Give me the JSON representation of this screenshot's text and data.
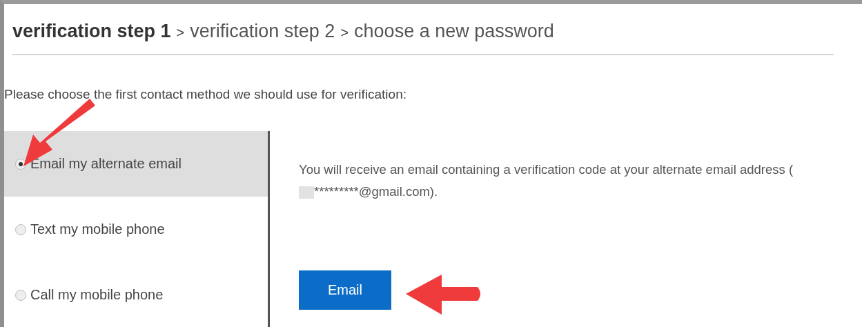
{
  "breadcrumb": {
    "separator": ">",
    "steps": [
      {
        "label": "verification step 1",
        "selected": true
      },
      {
        "label": "verification step 2",
        "selected": false
      },
      {
        "label": "choose a new password",
        "selected": false
      }
    ]
  },
  "prompt": "Please choose the first contact method we should use for verification:",
  "methods": [
    {
      "label": "Email my alternate email",
      "selected": true
    },
    {
      "label": "Text my mobile phone",
      "selected": false
    },
    {
      "label": "Call my mobile phone",
      "selected": false
    }
  ],
  "detail": {
    "text_before": "You will receive an email containing a verification code at your alternate email address (",
    "masked": "*********@gmail.com).",
    "button": "Email"
  }
}
